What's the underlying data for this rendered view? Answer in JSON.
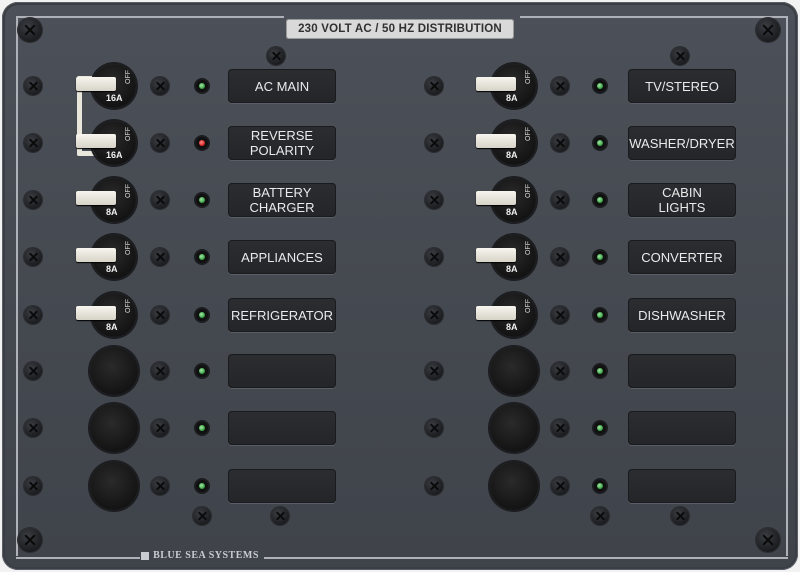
{
  "panel": {
    "title": "230 VOLT AC / 50 HZ DISTRIBUTION",
    "brand": "BLUE SEA SYSTEMS"
  },
  "left_column": [
    {
      "label": "AC MAIN",
      "rating": "16A",
      "off_text": "OFF",
      "type": "breaker",
      "led": "green"
    },
    {
      "label": "REVERSE\nPOLARITY",
      "rating": "16A",
      "off_text": "OFF",
      "type": "breaker",
      "led": "red"
    },
    {
      "label": "BATTERY\nCHARGER",
      "rating": "8A",
      "off_text": "OFF",
      "type": "breaker",
      "led": "green"
    },
    {
      "label": "APPLIANCES",
      "rating": "8A",
      "off_text": "OFF",
      "type": "breaker",
      "led": "green"
    },
    {
      "label": "REFRIGERATOR",
      "rating": "8A",
      "off_text": "OFF",
      "type": "breaker",
      "led": "green"
    },
    {
      "label": "",
      "type": "blank",
      "led": "green"
    },
    {
      "label": "",
      "type": "blank",
      "led": "green"
    },
    {
      "label": "",
      "type": "blank",
      "led": "green"
    }
  ],
  "right_column": [
    {
      "label": "TV/STEREO",
      "rating": "8A",
      "off_text": "OFF",
      "type": "breaker",
      "led": "green"
    },
    {
      "label": "WASHER/DRYER",
      "rating": "8A",
      "off_text": "OFF",
      "type": "breaker",
      "led": "green"
    },
    {
      "label": "CABIN\nLIGHTS",
      "rating": "8A",
      "off_text": "OFF",
      "type": "breaker",
      "led": "green"
    },
    {
      "label": "CONVERTER",
      "rating": "8A",
      "off_text": "OFF",
      "type": "breaker",
      "led": "green"
    },
    {
      "label": "DISHWASHER",
      "rating": "8A",
      "off_text": "OFF",
      "type": "breaker",
      "led": "green"
    },
    {
      "label": "",
      "type": "blank",
      "led": "green"
    },
    {
      "label": "",
      "type": "blank",
      "led": "green"
    },
    {
      "label": "",
      "type": "blank",
      "led": "green"
    }
  ],
  "colors": {
    "panel": "#464a51",
    "led_green": "#2f9a3a",
    "led_red": "#d11a1a",
    "lever": "#ecE8dd"
  }
}
